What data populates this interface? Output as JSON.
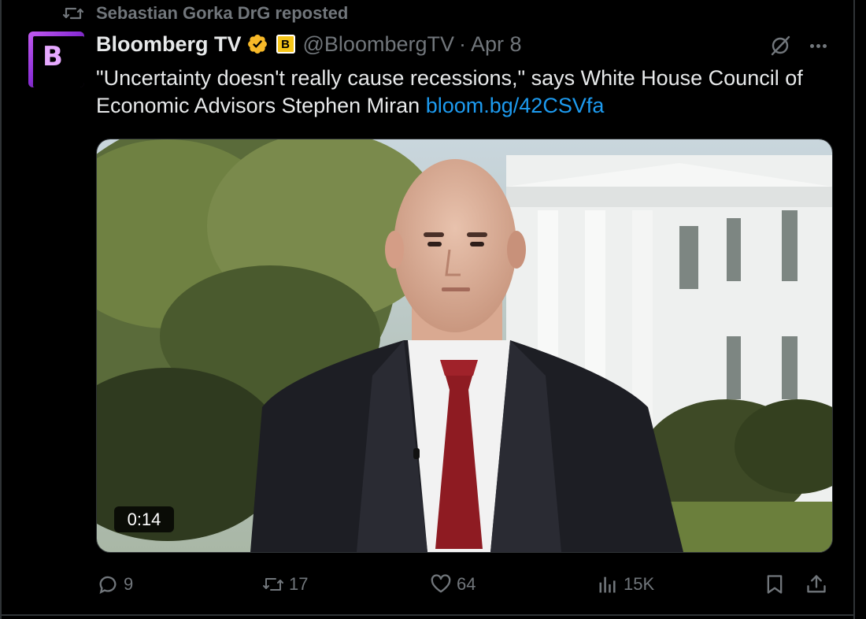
{
  "social_context": {
    "text": "Sebastian Gorka DrG reposted"
  },
  "author": {
    "name": "Bloomberg TV",
    "handle": "@BloombergTV",
    "separator": "·",
    "date": "Apr 8",
    "avatar_letter": "B",
    "affiliate_letter": "B",
    "verified_color": "#f7b928"
  },
  "tweet": {
    "text": "\"Uncertainty doesn't really cause recessions,\" says White House Council of Economic Advisors Stephen Miran",
    "link": "bloom.bg/42CSVfa"
  },
  "media": {
    "duration": "0:14"
  },
  "actions": {
    "replies": "9",
    "reposts": "17",
    "likes": "64",
    "views": "15K"
  },
  "icons": [
    "repost-icon",
    "verified-icon",
    "grok-icon",
    "more-icon",
    "reply-icon",
    "like-icon",
    "views-icon",
    "bookmark-icon",
    "share-icon"
  ],
  "colors": {
    "background": "#000000",
    "link": "#1d9bf0",
    "muted": "#71767b",
    "text": "#e7e9ea"
  }
}
